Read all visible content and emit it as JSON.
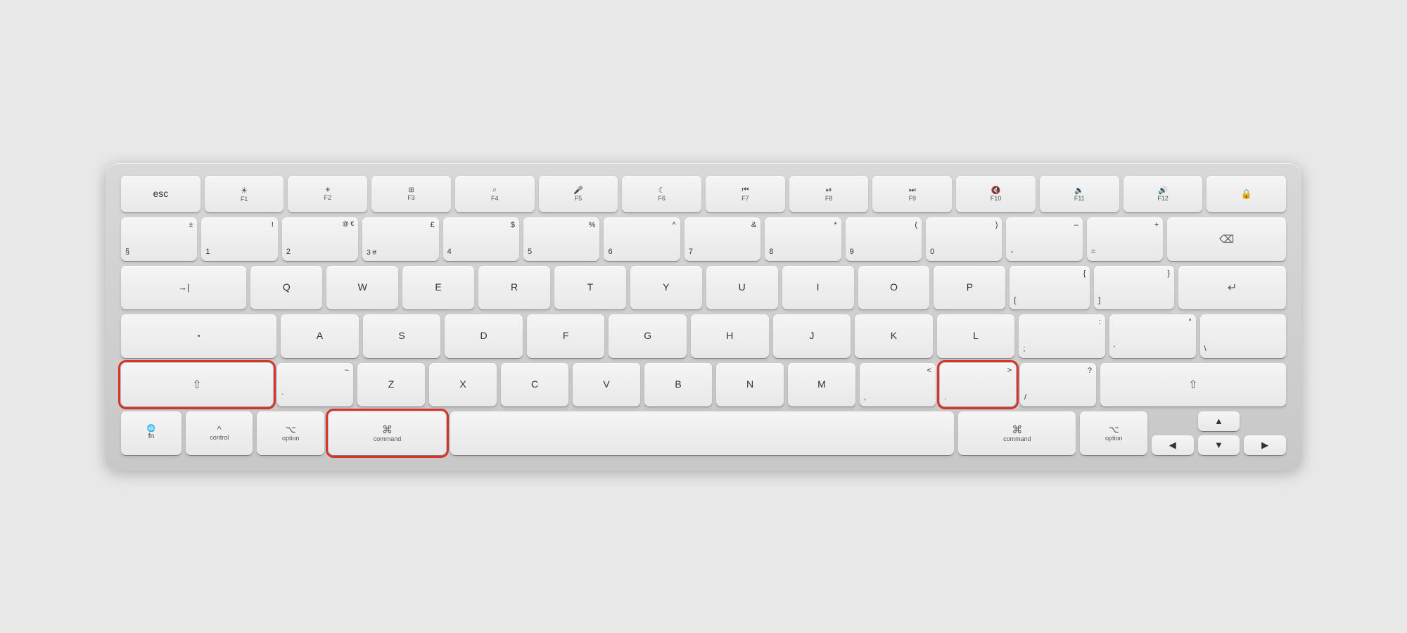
{
  "keyboard": {
    "rows": {
      "fn_row": [
        {
          "id": "esc",
          "main": "esc",
          "width": "normal"
        },
        {
          "id": "f1",
          "top": "☀",
          "main": "F1",
          "width": "normal"
        },
        {
          "id": "f2",
          "top": "☀",
          "main": "F2",
          "width": "normal"
        },
        {
          "id": "f3",
          "top": "⊞",
          "main": "F3",
          "width": "normal"
        },
        {
          "id": "f4",
          "top": "🔍",
          "main": "F4",
          "width": "normal"
        },
        {
          "id": "f5",
          "top": "🎤",
          "main": "F5",
          "width": "normal"
        },
        {
          "id": "f6",
          "top": "☾",
          "main": "F6",
          "width": "normal"
        },
        {
          "id": "f7",
          "top": "⏮",
          "main": "F7",
          "width": "normal"
        },
        {
          "id": "f8",
          "top": "⏯",
          "main": "F8",
          "width": "normal"
        },
        {
          "id": "f9",
          "top": "⏭",
          "main": "F9",
          "width": "normal"
        },
        {
          "id": "f10",
          "top": "🔇",
          "main": "F10",
          "width": "normal"
        },
        {
          "id": "f11",
          "top": "🔉",
          "main": "F11",
          "width": "normal"
        },
        {
          "id": "f12",
          "top": "🔊",
          "main": "F12",
          "width": "normal"
        },
        {
          "id": "lock",
          "top": "🔒",
          "main": "",
          "width": "normal"
        }
      ]
    }
  }
}
